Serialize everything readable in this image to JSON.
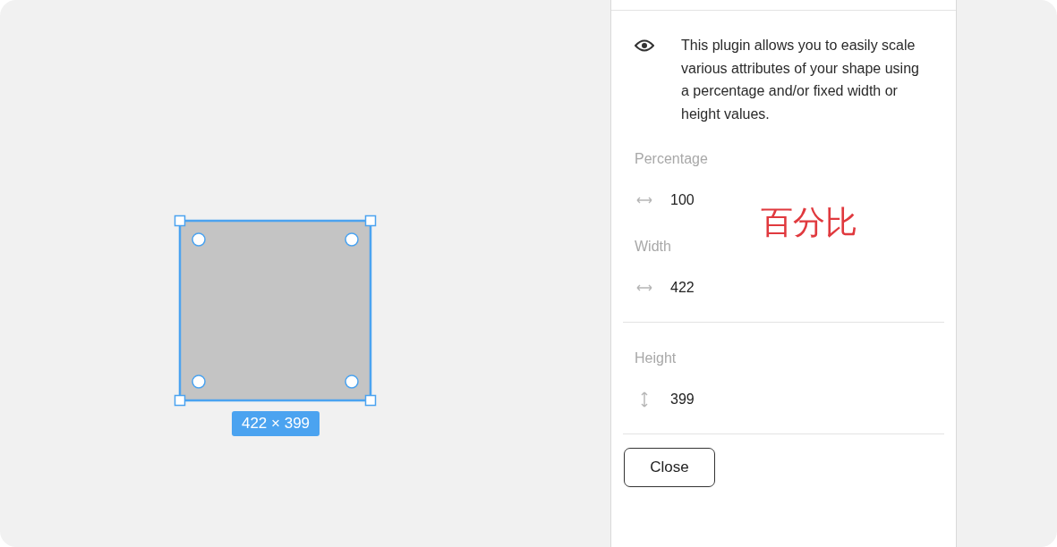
{
  "canvas": {
    "selection": {
      "size_label": "422 × 399"
    }
  },
  "annotation": {
    "text": "百分比"
  },
  "plugin_panel": {
    "description": "This plugin allows you to easily scale various attributes of your shape using a percentage and/or fixed width or height values.",
    "sections": [
      {
        "fields": [
          {
            "label": "Percentage",
            "value": "100",
            "kind": "horizontal"
          },
          {
            "label": "Width",
            "value": "422",
            "kind": "horizontal"
          }
        ]
      },
      {
        "fields": [
          {
            "label": "Height",
            "value": "399",
            "kind": "vertical"
          }
        ]
      }
    ],
    "buttons": [
      "Close"
    ]
  }
}
